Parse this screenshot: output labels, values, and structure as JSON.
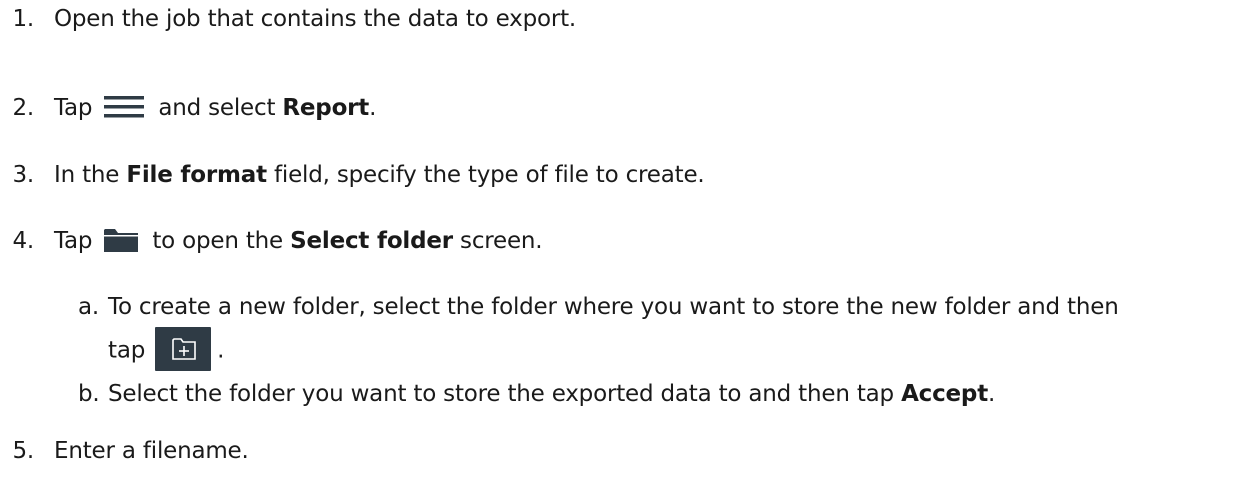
{
  "steps": [
    {
      "number": "1.",
      "text": "Open the job that contains the data to export."
    },
    {
      "number": "2.",
      "before": "Tap",
      "icon": "hamburger-menu-icon",
      "after": "and select",
      "bold": "Report",
      "end": "."
    },
    {
      "number": "3.",
      "before": "In the",
      "bold": "File format",
      "after": "field, specify the type of file to create."
    },
    {
      "number": "4.",
      "before": "Tap",
      "icon": "folder-icon",
      "after": "to open the",
      "bold": "Select folder",
      "end": "screen.",
      "substeps": [
        {
          "letter": "a.",
          "line1": "To create a new folder, select the folder where you want to store the new folder and then",
          "line2_before": "tap",
          "icon": "new-folder-icon",
          "line2_end": "."
        },
        {
          "letter": "b.",
          "before": "Select the folder you want to store the exported data to and then tap",
          "bold": "Accept",
          "end": "."
        }
      ]
    },
    {
      "number": "5.",
      "text": "Enter a filename."
    }
  ],
  "colors": {
    "text": "#1a1a1a",
    "icon_dark": "#2f3b45",
    "icon_light": "#ffffff"
  }
}
